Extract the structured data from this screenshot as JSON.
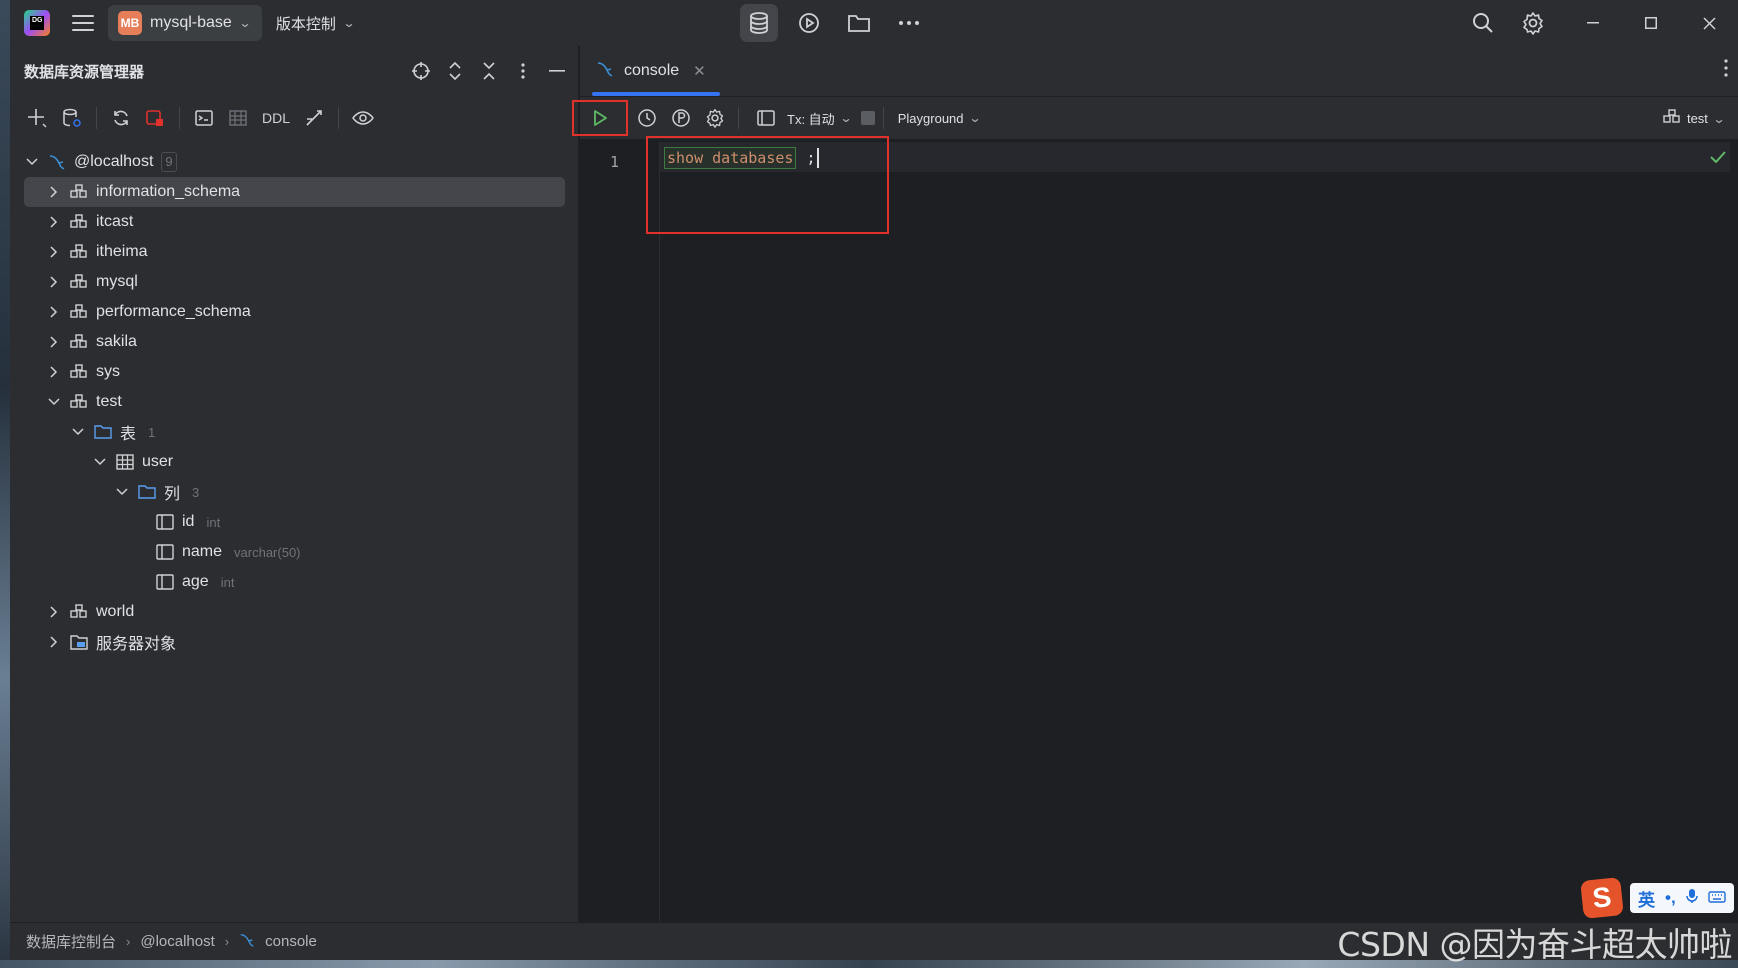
{
  "titlebar": {
    "logo_text": "DG",
    "project_badge": "MB",
    "project_name": "mysql-base",
    "vcs_label": "版本控制"
  },
  "db_panel": {
    "title": "数据库资源管理器",
    "toolbar_ddl": "DDL",
    "tree": {
      "root": {
        "label": "@localhost",
        "count": "9"
      },
      "schemas": [
        "information_schema",
        "itcast",
        "itheima",
        "mysql",
        "performance_schema",
        "sakila",
        "sys",
        "test"
      ],
      "tables_folder": {
        "label": "表",
        "count": "1"
      },
      "table": "user",
      "columns_folder": {
        "label": "列",
        "count": "3"
      },
      "columns": [
        {
          "name": "id",
          "type": "int"
        },
        {
          "name": "name",
          "type": "varchar(50)"
        },
        {
          "name": "age",
          "type": "int"
        }
      ],
      "after_schema": "world",
      "server_objects": "服务器对象"
    }
  },
  "editor": {
    "tab_label": "console",
    "tx_label": "Tx: 自动",
    "playground_label": "Playground",
    "session_label": "test",
    "line_number": "1",
    "code_keyword": "show databases",
    "code_semicolon": ";"
  },
  "statusbar": {
    "crumb1": "数据库控制台",
    "crumb2": "@localhost",
    "crumb3": "console"
  },
  "overlay": {
    "watermark": "CSDN @因为奋斗超太帅啦",
    "ime_lang": "英"
  },
  "colors": {
    "accent": "#3574f0",
    "highlight_red": "#e0312c",
    "keyword": "#cf8e6d",
    "run_green": "#5fb865"
  }
}
